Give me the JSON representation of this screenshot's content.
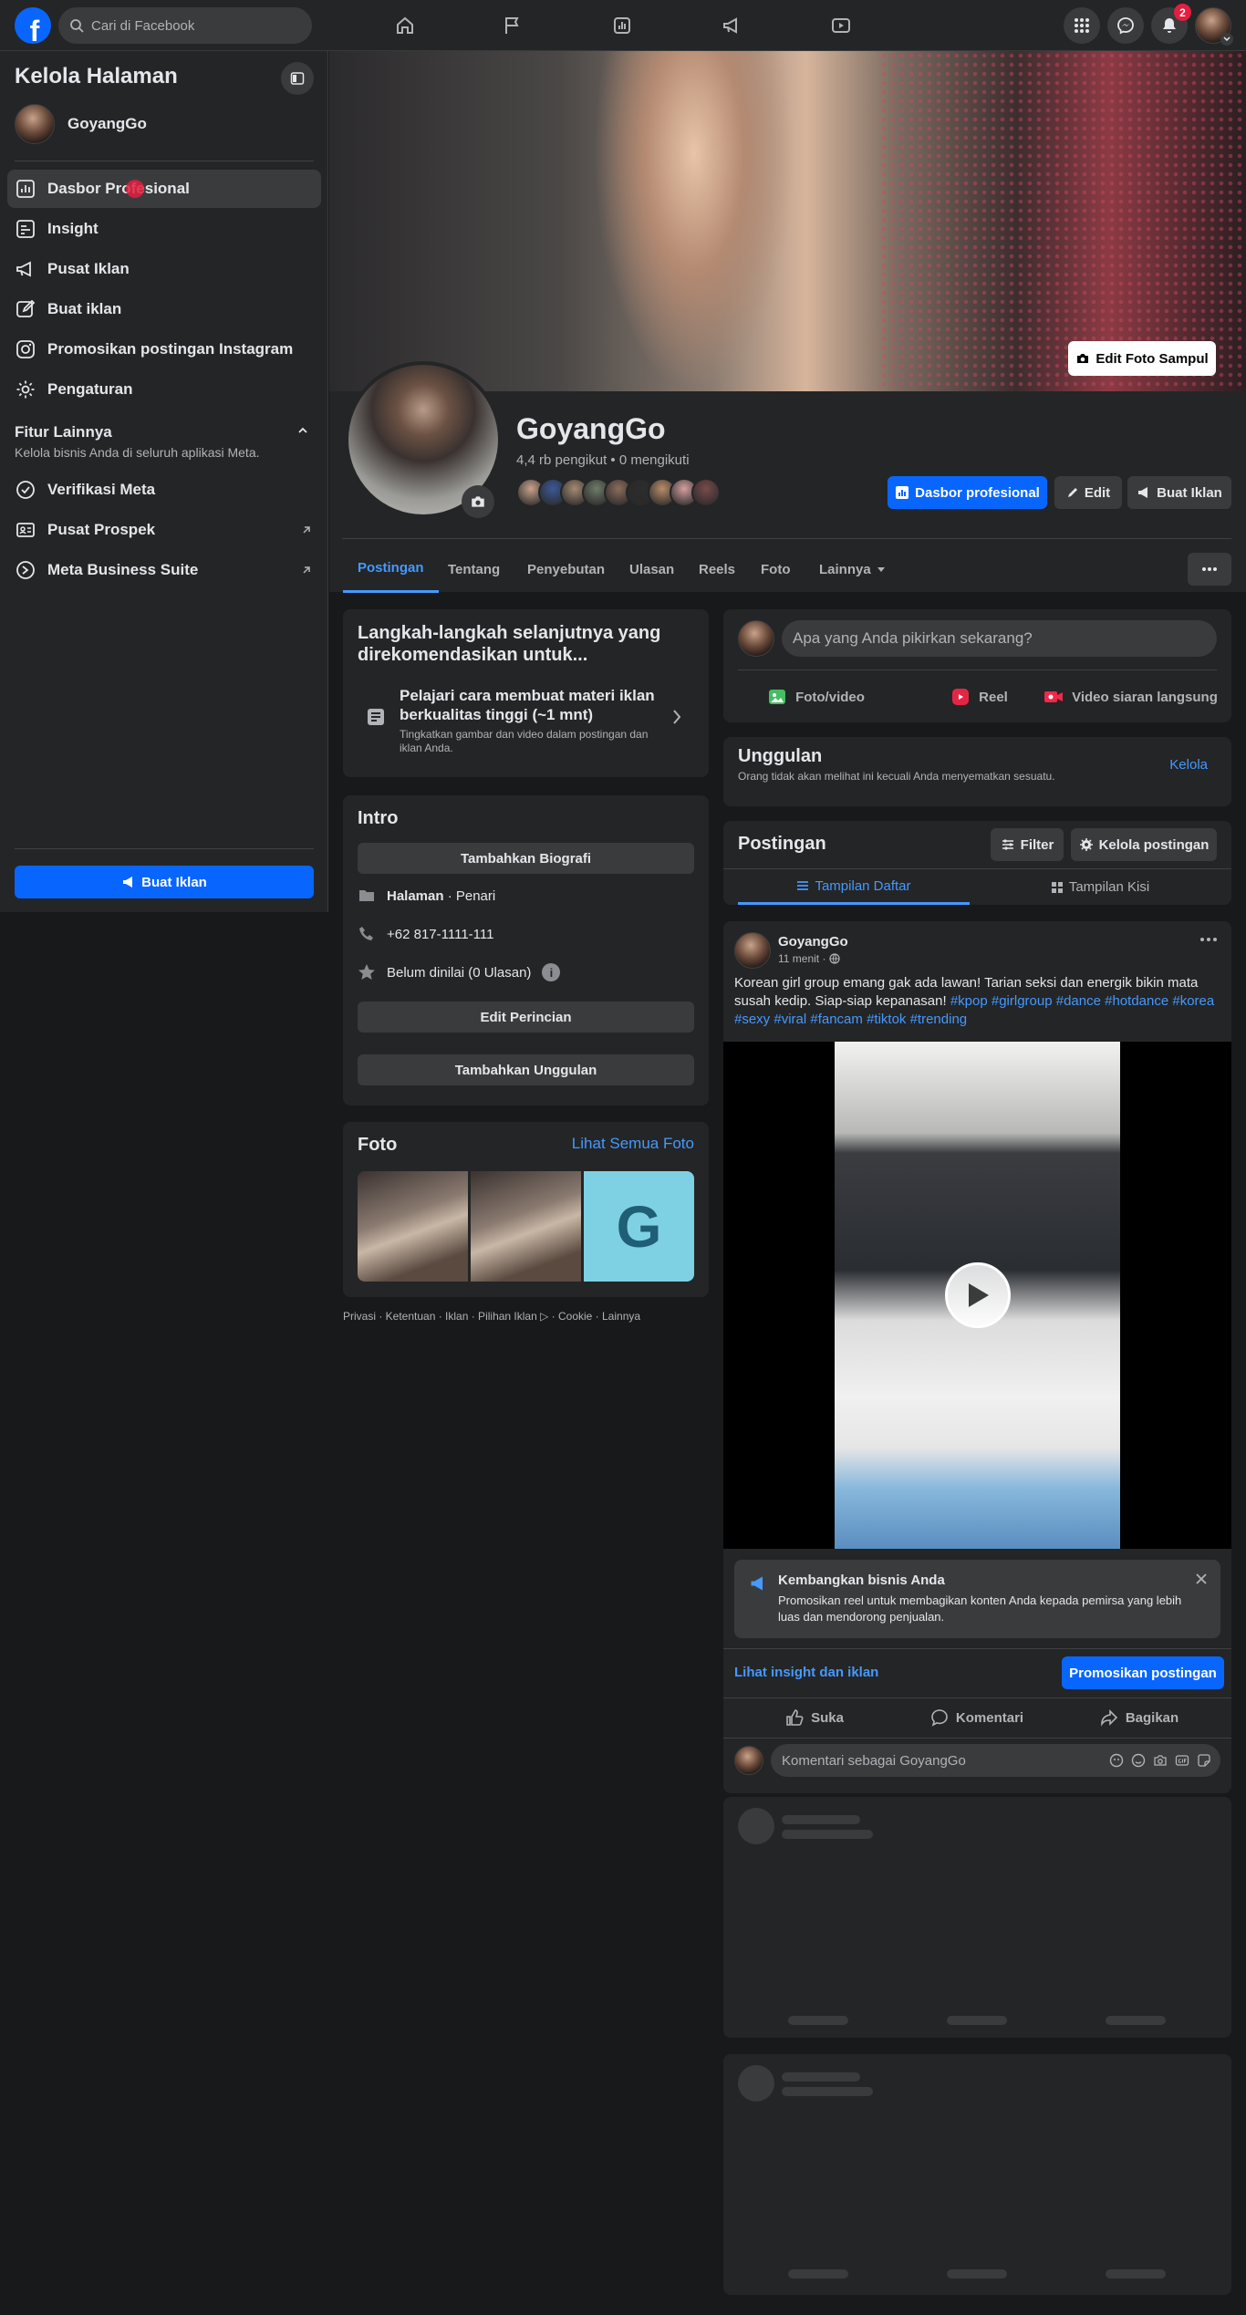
{
  "topbar": {
    "search_placeholder": "Cari di Facebook",
    "notification_count": "2",
    "logo_letter": "f"
  },
  "sidebar": {
    "title": "Kelola Halaman",
    "page_name": "GoyangGo",
    "items": [
      {
        "label": "Dasbor Profesional",
        "icon": "dashboard-icon"
      },
      {
        "label": "Insight",
        "icon": "insight-icon"
      },
      {
        "label": "Pusat Iklan",
        "icon": "megaphone-icon"
      },
      {
        "label": "Buat iklan",
        "icon": "edit-icon"
      },
      {
        "label": "Promosikan postingan Instagram",
        "icon": "instagram-icon"
      },
      {
        "label": "Pengaturan",
        "icon": "gear-icon"
      }
    ],
    "section_title": "Fitur Lainnya",
    "section_subtitle": "Kelola bisnis Anda di seluruh aplikasi Meta.",
    "more_items": [
      {
        "label": "Verifikasi Meta",
        "icon": "verified-icon"
      },
      {
        "label": "Pusat Prospek",
        "icon": "lead-icon"
      },
      {
        "label": "Meta Business Suite",
        "icon": "business-suite-icon"
      }
    ],
    "create_ad_button": "Buat Iklan"
  },
  "cover": {
    "edit_button": "Edit Foto Sampul"
  },
  "profile": {
    "name": "GoyangGo",
    "stats": "4,4 rb pengikut • 0 mengikuti",
    "dashboard_button": "Dasbor profesional",
    "edit_button": "Edit",
    "create_ad_button": "Buat Iklan",
    "follower_colors": [
      "#c9a28a",
      "#3b5998",
      "#a58b74",
      "#6e7b6a",
      "#8b6d5c",
      "#2c2c2c",
      "#b98c6a",
      "#d4a0a0",
      "#7a4a4a"
    ]
  },
  "tabs": [
    "Postingan",
    "Tentang",
    "Penyebutan",
    "Ulasan",
    "Reels",
    "Foto",
    "Lainnya"
  ],
  "next_steps": {
    "title": "Langkah-langkah selanjutnya yang direkomendasikan untuk...",
    "item_title": "Pelajari cara membuat materi iklan berkualitas tinggi (~1 mnt)",
    "item_desc": "Tingkatkan gambar dan video dalam postingan dan iklan Anda."
  },
  "intro": {
    "title": "Intro",
    "add_bio": "Tambahkan Biografi",
    "category_bold": "Halaman",
    "category_rest": " · Penari",
    "phone": "+62 817-1111-111",
    "rating": "Belum dinilai (0 Ulasan)",
    "edit_details": "Edit Perincian",
    "add_featured": "Tambahkan Unggulan"
  },
  "photos": {
    "title": "Foto",
    "see_all": "Lihat Semua Foto",
    "tile_letter": "G"
  },
  "footer": "Privasi · Ketentuan · Iklan · Pilihan Iklan ▷ · Cookie · Lainnya",
  "composer": {
    "placeholder": "Apa yang Anda pikirkan sekarang?",
    "photo_video": "Foto/video",
    "reel": "Reel",
    "live": "Video siaran langsung"
  },
  "featured": {
    "title": "Unggulan",
    "desc": "Orang tidak akan melihat ini kecuali Anda menyematkan sesuatu.",
    "manage": "Kelola"
  },
  "posts_header": {
    "title": "Postingan",
    "filter": "Filter",
    "manage": "Kelola postingan",
    "list_view": "Tampilan Daftar",
    "grid_view": "Tampilan Kisi"
  },
  "post": {
    "author": "GoyangGo",
    "time": "11 menit ·",
    "text": "Korean girl group emang gak ada lawan! Tarian seksi dan energik bikin mata susah kedip. Siap-siap kepanasan!",
    "hashtags": "#kpop #girlgroup #dance #hotdance #korea #sexy #viral #fancam #tiktok #trending",
    "promo_title": "Kembangkan bisnis Anda",
    "promo_desc": "Promosikan reel untuk membagikan konten Anda kepada pemirsa yang lebih luas dan mendorong penjualan.",
    "insight_link": "Lihat insight dan iklan",
    "promote_button": "Promosikan postingan",
    "like": "Suka",
    "comment": "Komentari",
    "share": "Bagikan",
    "comment_placeholder": "Komentari sebagai GoyangGo"
  }
}
